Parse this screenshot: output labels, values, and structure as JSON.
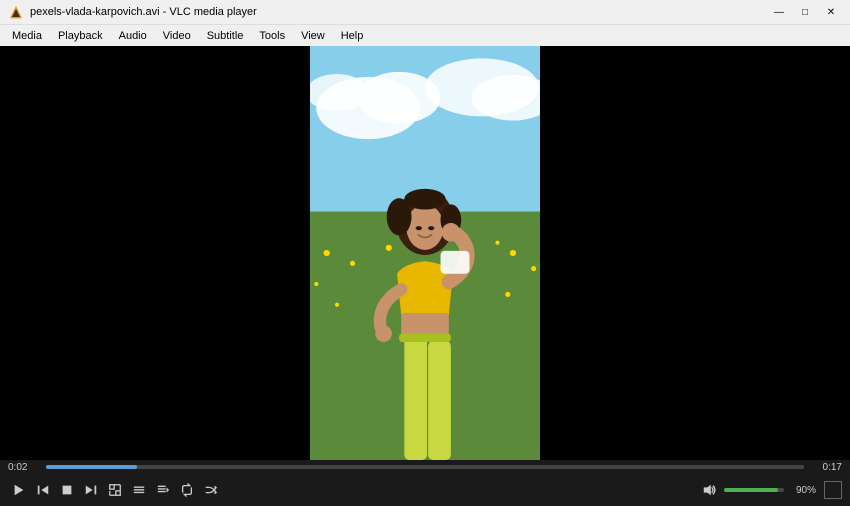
{
  "titleBar": {
    "title": "pexels-vlada-karpovich.avi - VLC media player",
    "icon": "vlc-cone"
  },
  "windowControls": {
    "minimize": "—",
    "maximize": "□",
    "close": "✕"
  },
  "menuBar": {
    "items": [
      "Media",
      "Playback",
      "Audio",
      "Video",
      "Subtitle",
      "Tools",
      "View",
      "Help"
    ]
  },
  "controls": {
    "timeCurrent": "0:02",
    "timeTotal": "0:17",
    "progressPercent": 12,
    "volumePercent": 90,
    "volumeLabel": "90%"
  }
}
